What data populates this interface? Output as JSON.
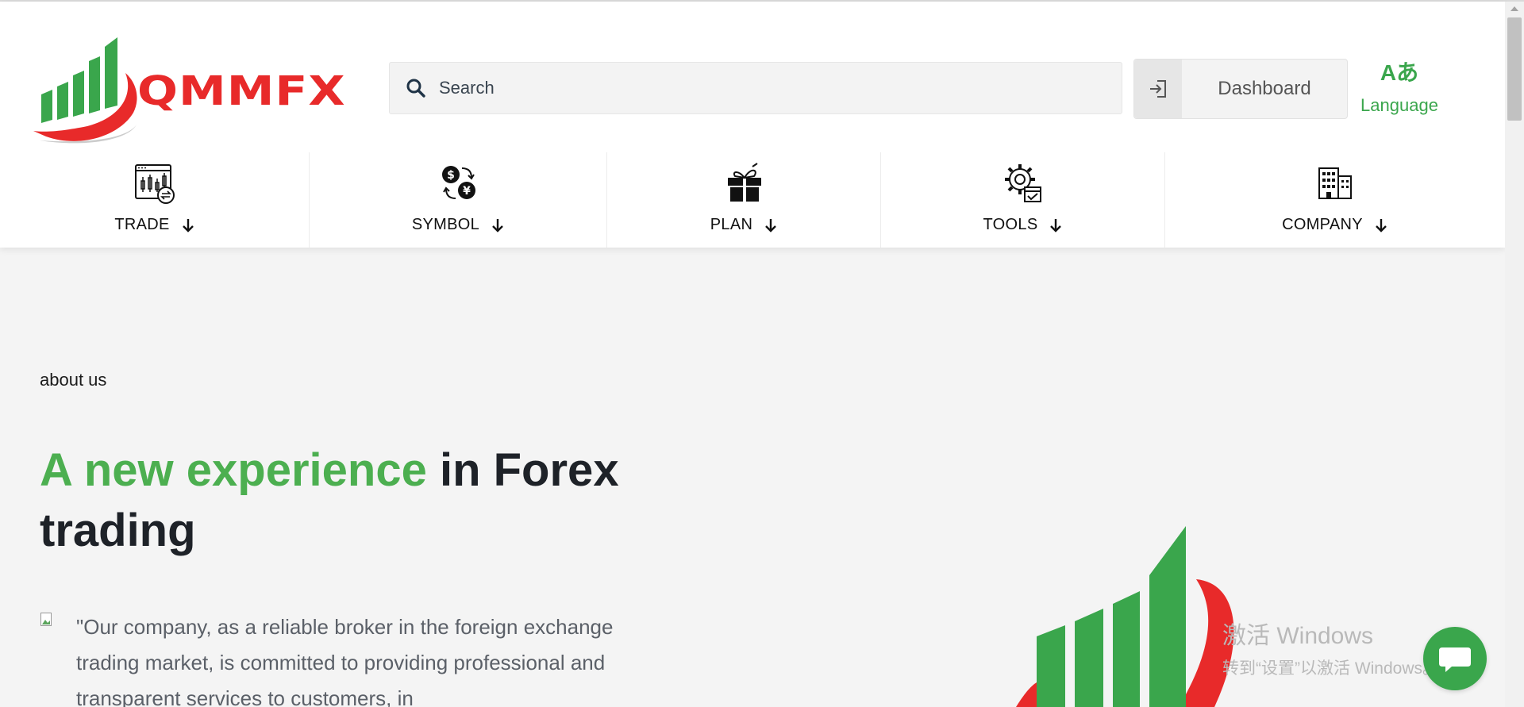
{
  "header": {
    "logo_text": "QMMFX",
    "search": {
      "placeholder": "Search",
      "value": ""
    },
    "dashboard_label": "Dashboard",
    "language_glyph": "Aあ",
    "language_label": "Language"
  },
  "nav": {
    "items": [
      {
        "label": "TRADE",
        "icon": "candlestick-chart-icon"
      },
      {
        "label": "SYMBOL",
        "icon": "currency-exchange-icon"
      },
      {
        "label": "PLAN",
        "icon": "gift-icon"
      },
      {
        "label": "TOOLS",
        "icon": "gear-tools-icon"
      },
      {
        "label": "COMPANY",
        "icon": "building-icon"
      }
    ]
  },
  "main": {
    "about_label": "about us",
    "headline_accent": "A new experience",
    "headline_rest": " in Forex trading",
    "quote": "\"Our company, as a reliable broker in the foreign exchange trading market, is committed to providing professional and transparent services to customers, in"
  },
  "overlay": {
    "watermark_title": "激活 Windows",
    "watermark_sub": "转到“设置”以激活 Windows。"
  },
  "colors": {
    "brand_green": "#3aa64c",
    "brand_red": "#e82a2a",
    "headline_accent": "#4caf50"
  }
}
